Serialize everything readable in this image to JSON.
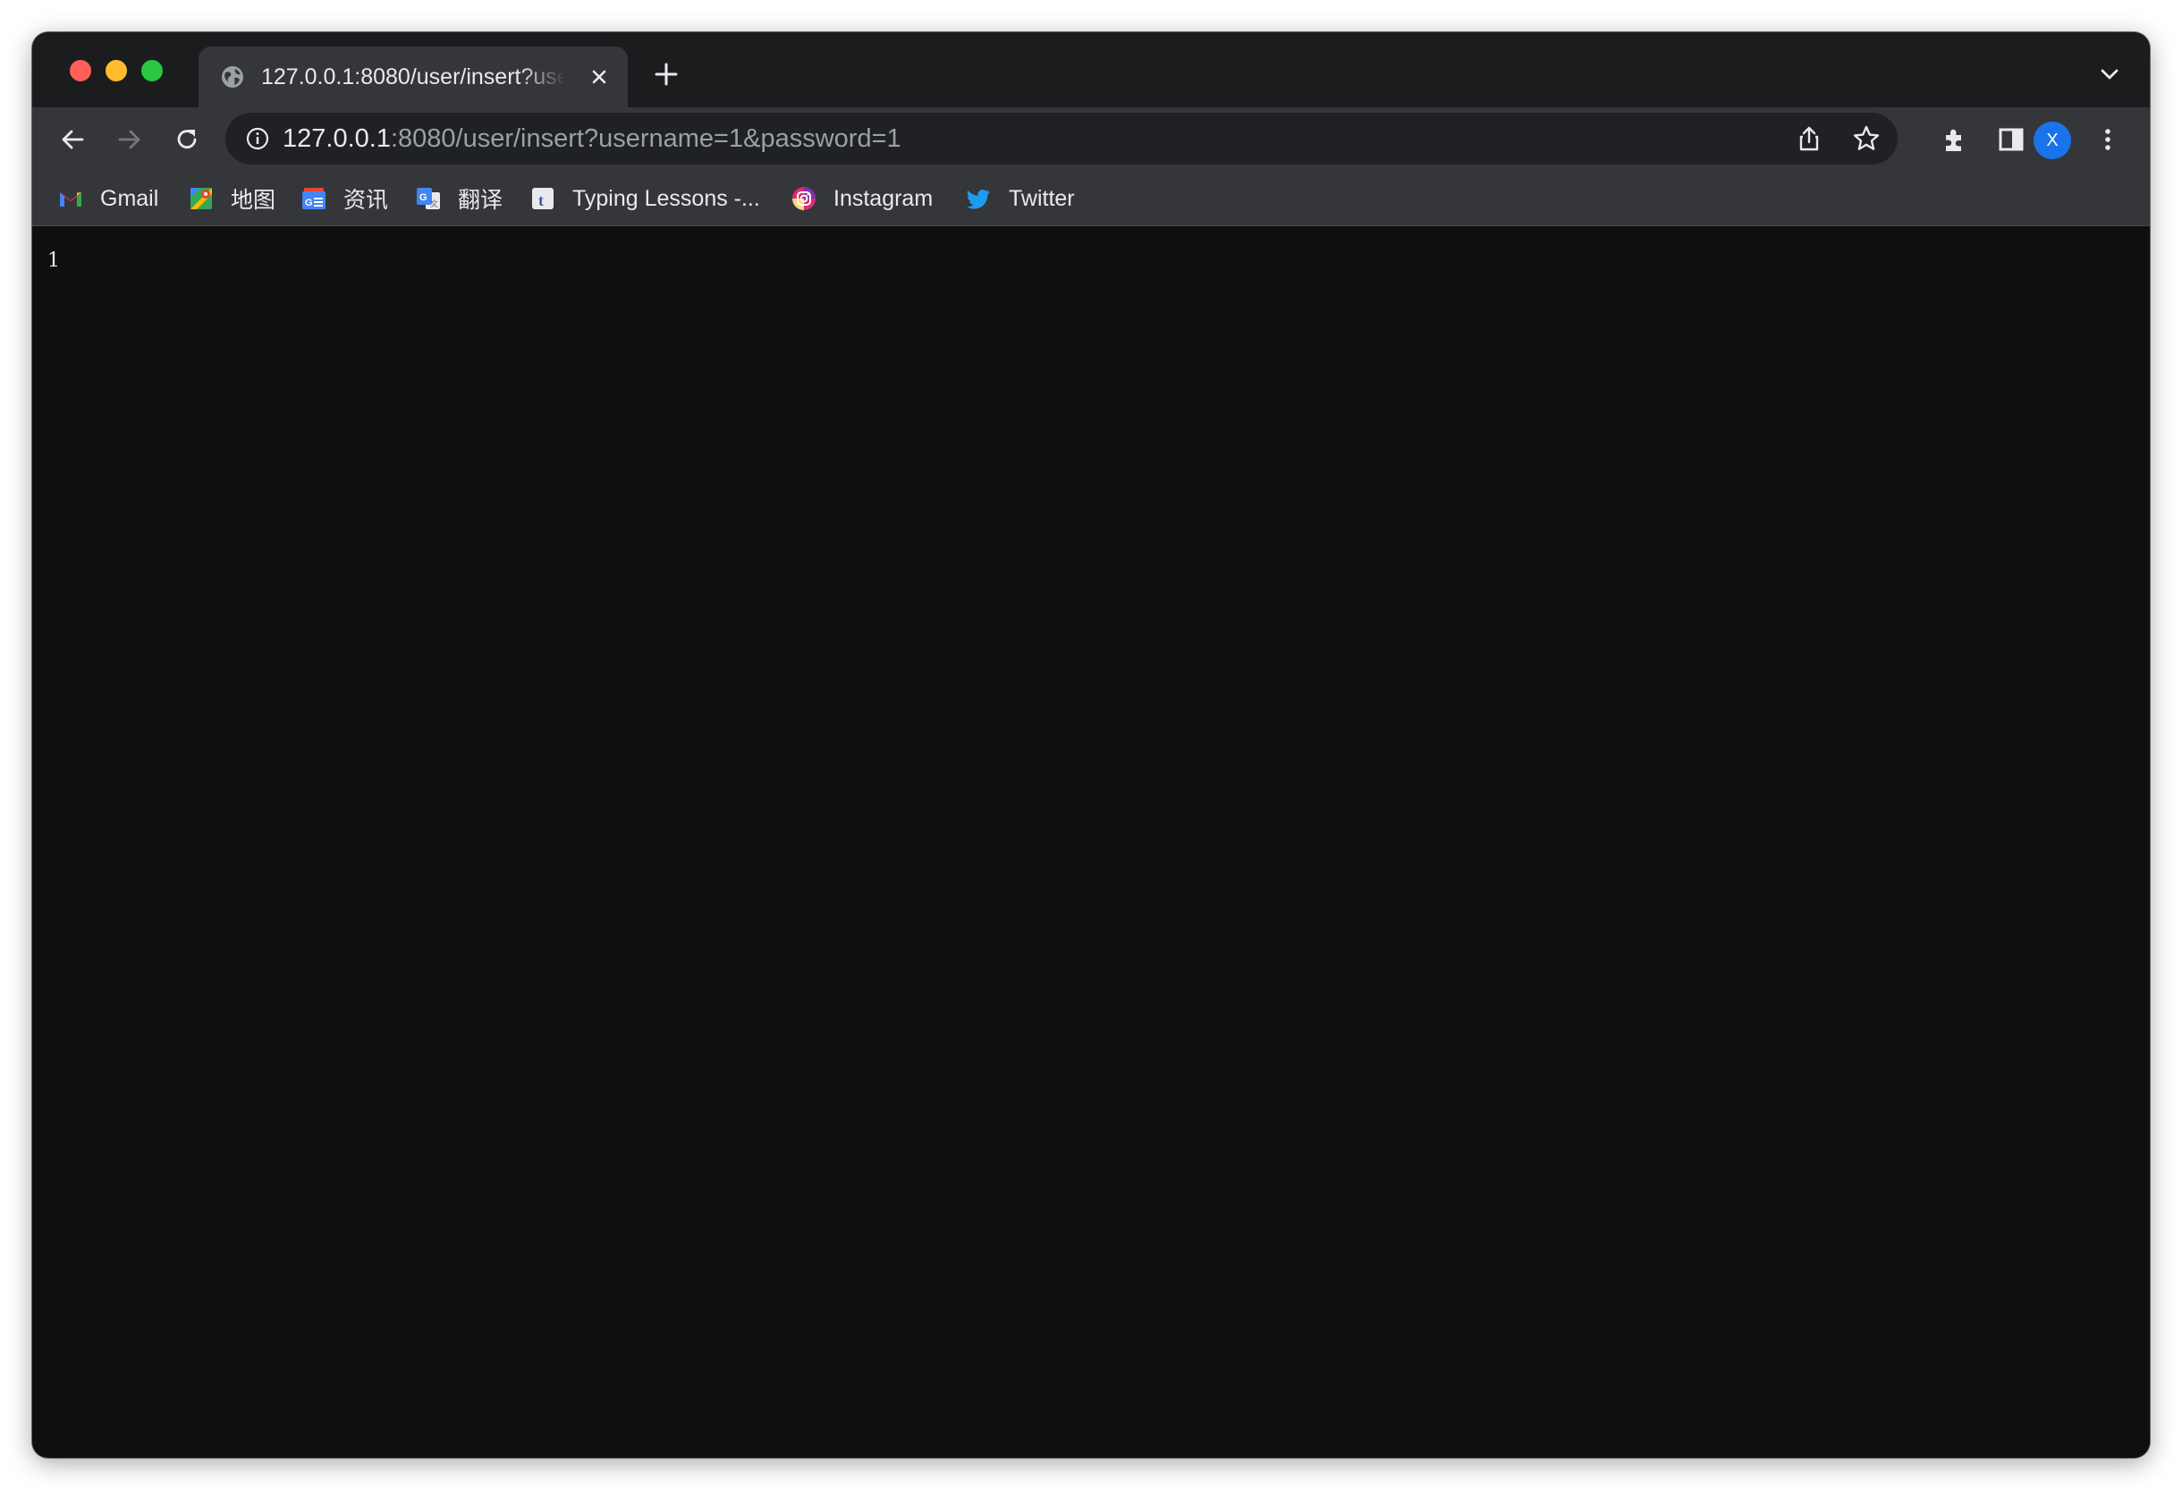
{
  "tab": {
    "title": "127.0.0.1:8080/user/insert?username=1&password=1"
  },
  "omnibox": {
    "host": "127.0.0.1",
    "rest": ":8080/user/insert?username=1&password=1"
  },
  "profile": {
    "initial": "X",
    "color": "#1a73e8"
  },
  "bookmarks": [
    {
      "label": "Gmail",
      "icon": "gmail-icon"
    },
    {
      "label": "地图",
      "icon": "maps-icon"
    },
    {
      "label": "资讯",
      "icon": "news-icon"
    },
    {
      "label": "翻译",
      "icon": "translate-icon"
    },
    {
      "label": "Typing Lessons -...",
      "icon": "typing-icon"
    },
    {
      "label": "Instagram",
      "icon": "instagram-icon"
    },
    {
      "label": "Twitter",
      "icon": "twitter-icon"
    }
  ],
  "page": {
    "body_text": "1"
  },
  "colors": {
    "tab_active": "#35363a",
    "tabstrip": "#1b1c1e",
    "omnibox": "#202124",
    "page_background": "#0f0f10"
  }
}
